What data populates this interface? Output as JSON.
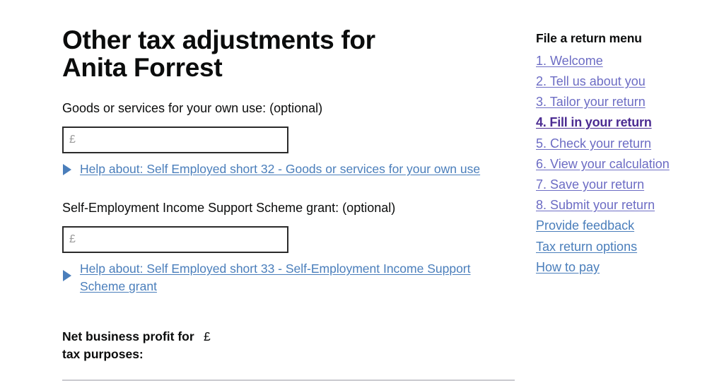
{
  "page": {
    "title": "Other tax adjustments for Anita Forrest",
    "background": "#ffffff"
  },
  "colors": {
    "text": "#0b0c0c",
    "help_link": "#4a7ebb",
    "sidebar_link": "#6c6cc4",
    "sidebar_current": "#4c2c92",
    "input_border": "#2b2b2b",
    "rule": "#c9c9ce",
    "placeholder": "#9a9a9a"
  },
  "fields": [
    {
      "label": "Goods or services for your own use: (optional)",
      "value": "",
      "placeholder": "£",
      "help_text": "Help about: Self Employed short 32 - Goods or services for your own use",
      "marker_icon": "disclosure-triangle-right-icon"
    },
    {
      "label": "Self-Employment Income Support Scheme grant: (optional)",
      "value": "",
      "placeholder": "£",
      "help_text": "Help about: Self Employed short 33 - Self-Employment Income Support Scheme grant",
      "marker_icon": "disclosure-triangle-right-icon"
    }
  ],
  "net_profit": {
    "label": "Net business profit for tax purposes:",
    "value": "£"
  },
  "sidebar": {
    "title": "File a return menu",
    "items": [
      {
        "label": "1. Welcome",
        "current": false,
        "style": "purple"
      },
      {
        "label": "2. Tell us about you",
        "current": false,
        "style": "purple"
      },
      {
        "label": "3. Tailor your return",
        "current": false,
        "style": "purple"
      },
      {
        "label": "4. Fill in your return",
        "current": true,
        "style": "current"
      },
      {
        "label": "5. Check your return",
        "current": false,
        "style": "purple"
      },
      {
        "label": "6. View your calculation",
        "current": false,
        "style": "purple"
      },
      {
        "label": "7. Save your return",
        "current": false,
        "style": "purple"
      },
      {
        "label": "8. Submit your return",
        "current": false,
        "style": "purple"
      },
      {
        "label": "Provide feedback",
        "current": false,
        "style": "blue"
      },
      {
        "label": "Tax return options",
        "current": false,
        "style": "blue"
      },
      {
        "label": "How to pay",
        "current": false,
        "style": "blue"
      }
    ]
  }
}
